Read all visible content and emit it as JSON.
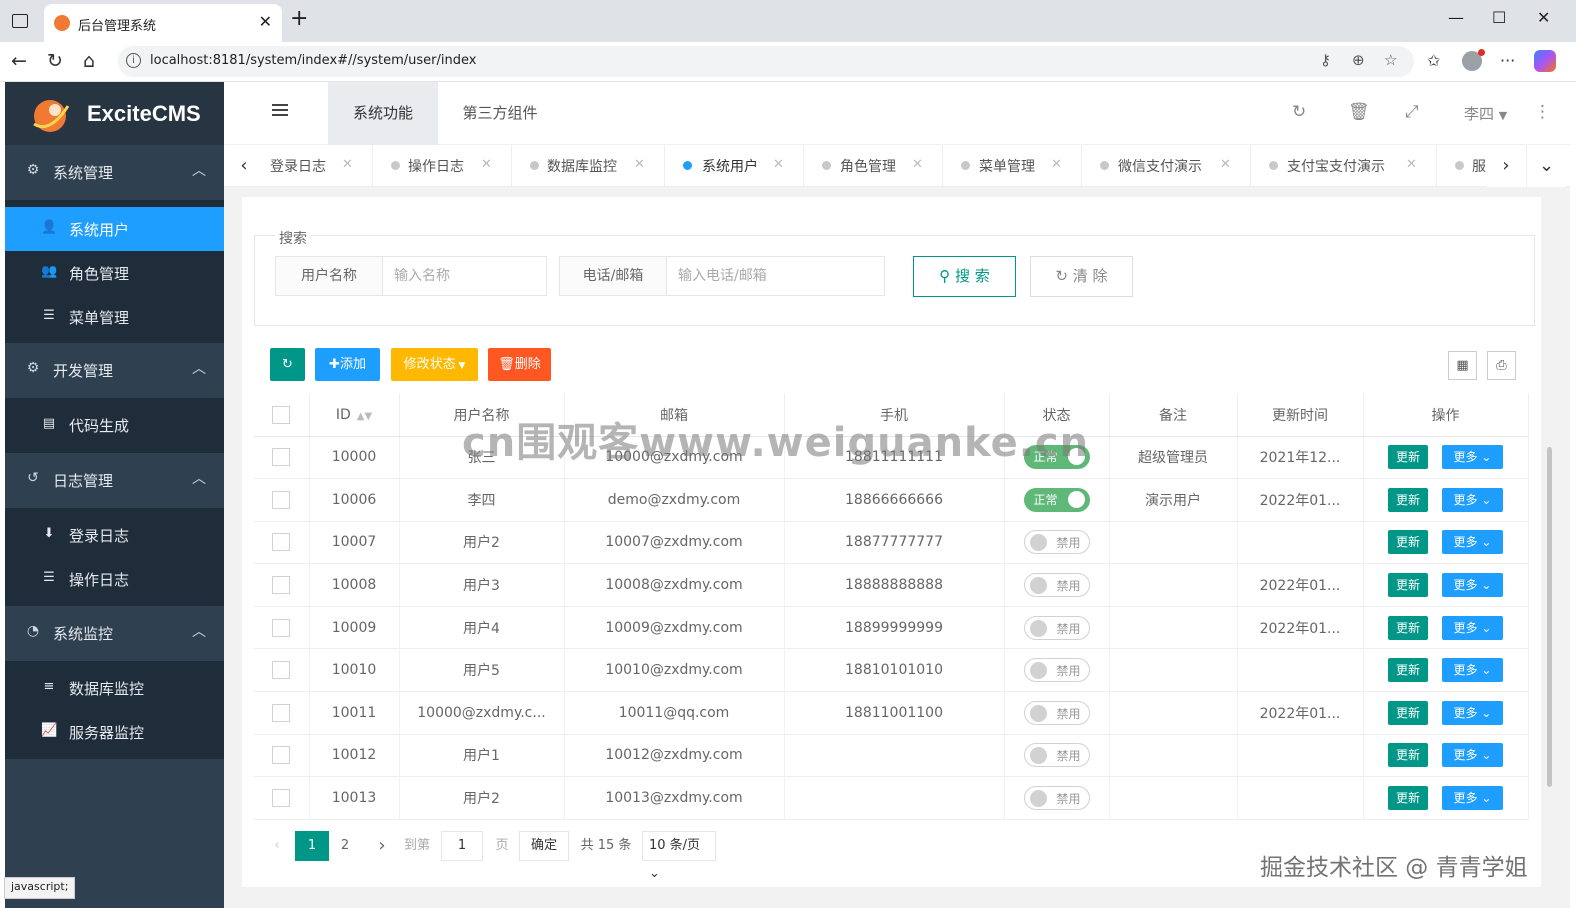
{
  "browser": {
    "tab_title": "后台管理系统",
    "url": "localhost:8181/system/index#//system/user/index",
    "status_text": "javascript;"
  },
  "app": {
    "brand": "ExciteCMS"
  },
  "sidebar": {
    "groups": [
      {
        "label": "系统管理",
        "icon": "gear-icon",
        "items": [
          {
            "label": "系统用户",
            "icon": "user-icon",
            "active": true
          },
          {
            "label": "角色管理",
            "icon": "users-icon"
          },
          {
            "label": "菜单管理",
            "icon": "list-icon"
          }
        ]
      },
      {
        "label": "开发管理",
        "icon": "gears-icon",
        "items": [
          {
            "label": "代码生成",
            "icon": "code-file-icon"
          }
        ]
      },
      {
        "label": "日志管理",
        "icon": "history-icon",
        "items": [
          {
            "label": "登录日志",
            "icon": "login-icon"
          },
          {
            "label": "操作日志",
            "icon": "sliders-icon"
          }
        ]
      },
      {
        "label": "系统监控",
        "icon": "dashboard-icon",
        "items": [
          {
            "label": "数据库监控",
            "icon": "database-icon"
          },
          {
            "label": "服务器监控",
            "icon": "chart-icon"
          }
        ]
      }
    ]
  },
  "header": {
    "tabs": [
      "系统功能",
      "第三方组件"
    ],
    "user": "李四"
  },
  "page_tabs": [
    "登录日志",
    "操作日志",
    "数据库监控",
    "系统用户",
    "角色管理",
    "菜单管理",
    "微信支付演示",
    "支付宝支付演示",
    "服"
  ],
  "search": {
    "legend": "搜索",
    "name_label": "用户名称",
    "name_placeholder": "输入名称",
    "contact_label": "电话/邮箱",
    "contact_placeholder": "输入电话/邮箱",
    "search_btn": "搜 索",
    "clear_btn": "清 除"
  },
  "toolbar": {
    "add": "添加",
    "status": "修改状态",
    "delete": "删除"
  },
  "table": {
    "columns": [
      "ID",
      "用户名称",
      "邮箱",
      "手机",
      "状态",
      "备注",
      "更新时间",
      "操作"
    ],
    "rows": [
      {
        "id": "10000",
        "name": "张三",
        "email": "10000@zxdmy.com",
        "phone": "18811111111",
        "status_on": true,
        "status": "正常",
        "remark": "超级管理员",
        "updated": "2021年12..."
      },
      {
        "id": "10006",
        "name": "李四",
        "email": "demo@zxdmy.com",
        "phone": "18866666666",
        "status_on": true,
        "status": "正常",
        "remark": "演示用户",
        "updated": "2022年01..."
      },
      {
        "id": "10007",
        "name": "用户2",
        "email": "10007@zxdmy.com",
        "phone": "18877777777",
        "status_on": false,
        "status": "禁用",
        "remark": "",
        "updated": ""
      },
      {
        "id": "10008",
        "name": "用户3",
        "email": "10008@zxdmy.com",
        "phone": "18888888888",
        "status_on": false,
        "status": "禁用",
        "remark": "",
        "updated": "2022年01..."
      },
      {
        "id": "10009",
        "name": "用户4",
        "email": "10009@zxdmy.com",
        "phone": "18899999999",
        "status_on": false,
        "status": "禁用",
        "remark": "",
        "updated": "2022年01..."
      },
      {
        "id": "10010",
        "name": "用户5",
        "email": "10010@zxdmy.com",
        "phone": "18810101010",
        "status_on": false,
        "status": "禁用",
        "remark": "",
        "updated": ""
      },
      {
        "id": "10011",
        "name": "10000@zxdmy.c...",
        "email": "10011@qq.com",
        "phone": "18811001100",
        "status_on": false,
        "status": "禁用",
        "remark": "",
        "updated": "2022年01..."
      },
      {
        "id": "10012",
        "name": "用户1",
        "email": "10012@zxdmy.com",
        "phone": "",
        "status_on": false,
        "status": "禁用",
        "remark": "",
        "updated": ""
      },
      {
        "id": "10013",
        "name": "用户2",
        "email": "10013@zxdmy.com",
        "phone": "",
        "status_on": false,
        "status": "禁用",
        "remark": "",
        "updated": ""
      }
    ],
    "update_label": "更新",
    "more_label": "更多"
  },
  "pager": {
    "pages": [
      "1",
      "2"
    ],
    "current": "1",
    "goto_label": "到第",
    "goto_value": "1",
    "page_unit": "页",
    "confirm": "确定",
    "total": "共 15 条",
    "per_page": "10 条/页"
  },
  "watermarks": {
    "main": "cn围观客www.weiguanke.cn",
    "corner": "掘金技术社区 @ 青青学姐"
  },
  "colors": {
    "sidebar": "#2f4050",
    "active": "#1e9fff",
    "primary": "#009688",
    "warm": "#FFB800",
    "danger": "#FF5722",
    "success": "#5FB878"
  }
}
